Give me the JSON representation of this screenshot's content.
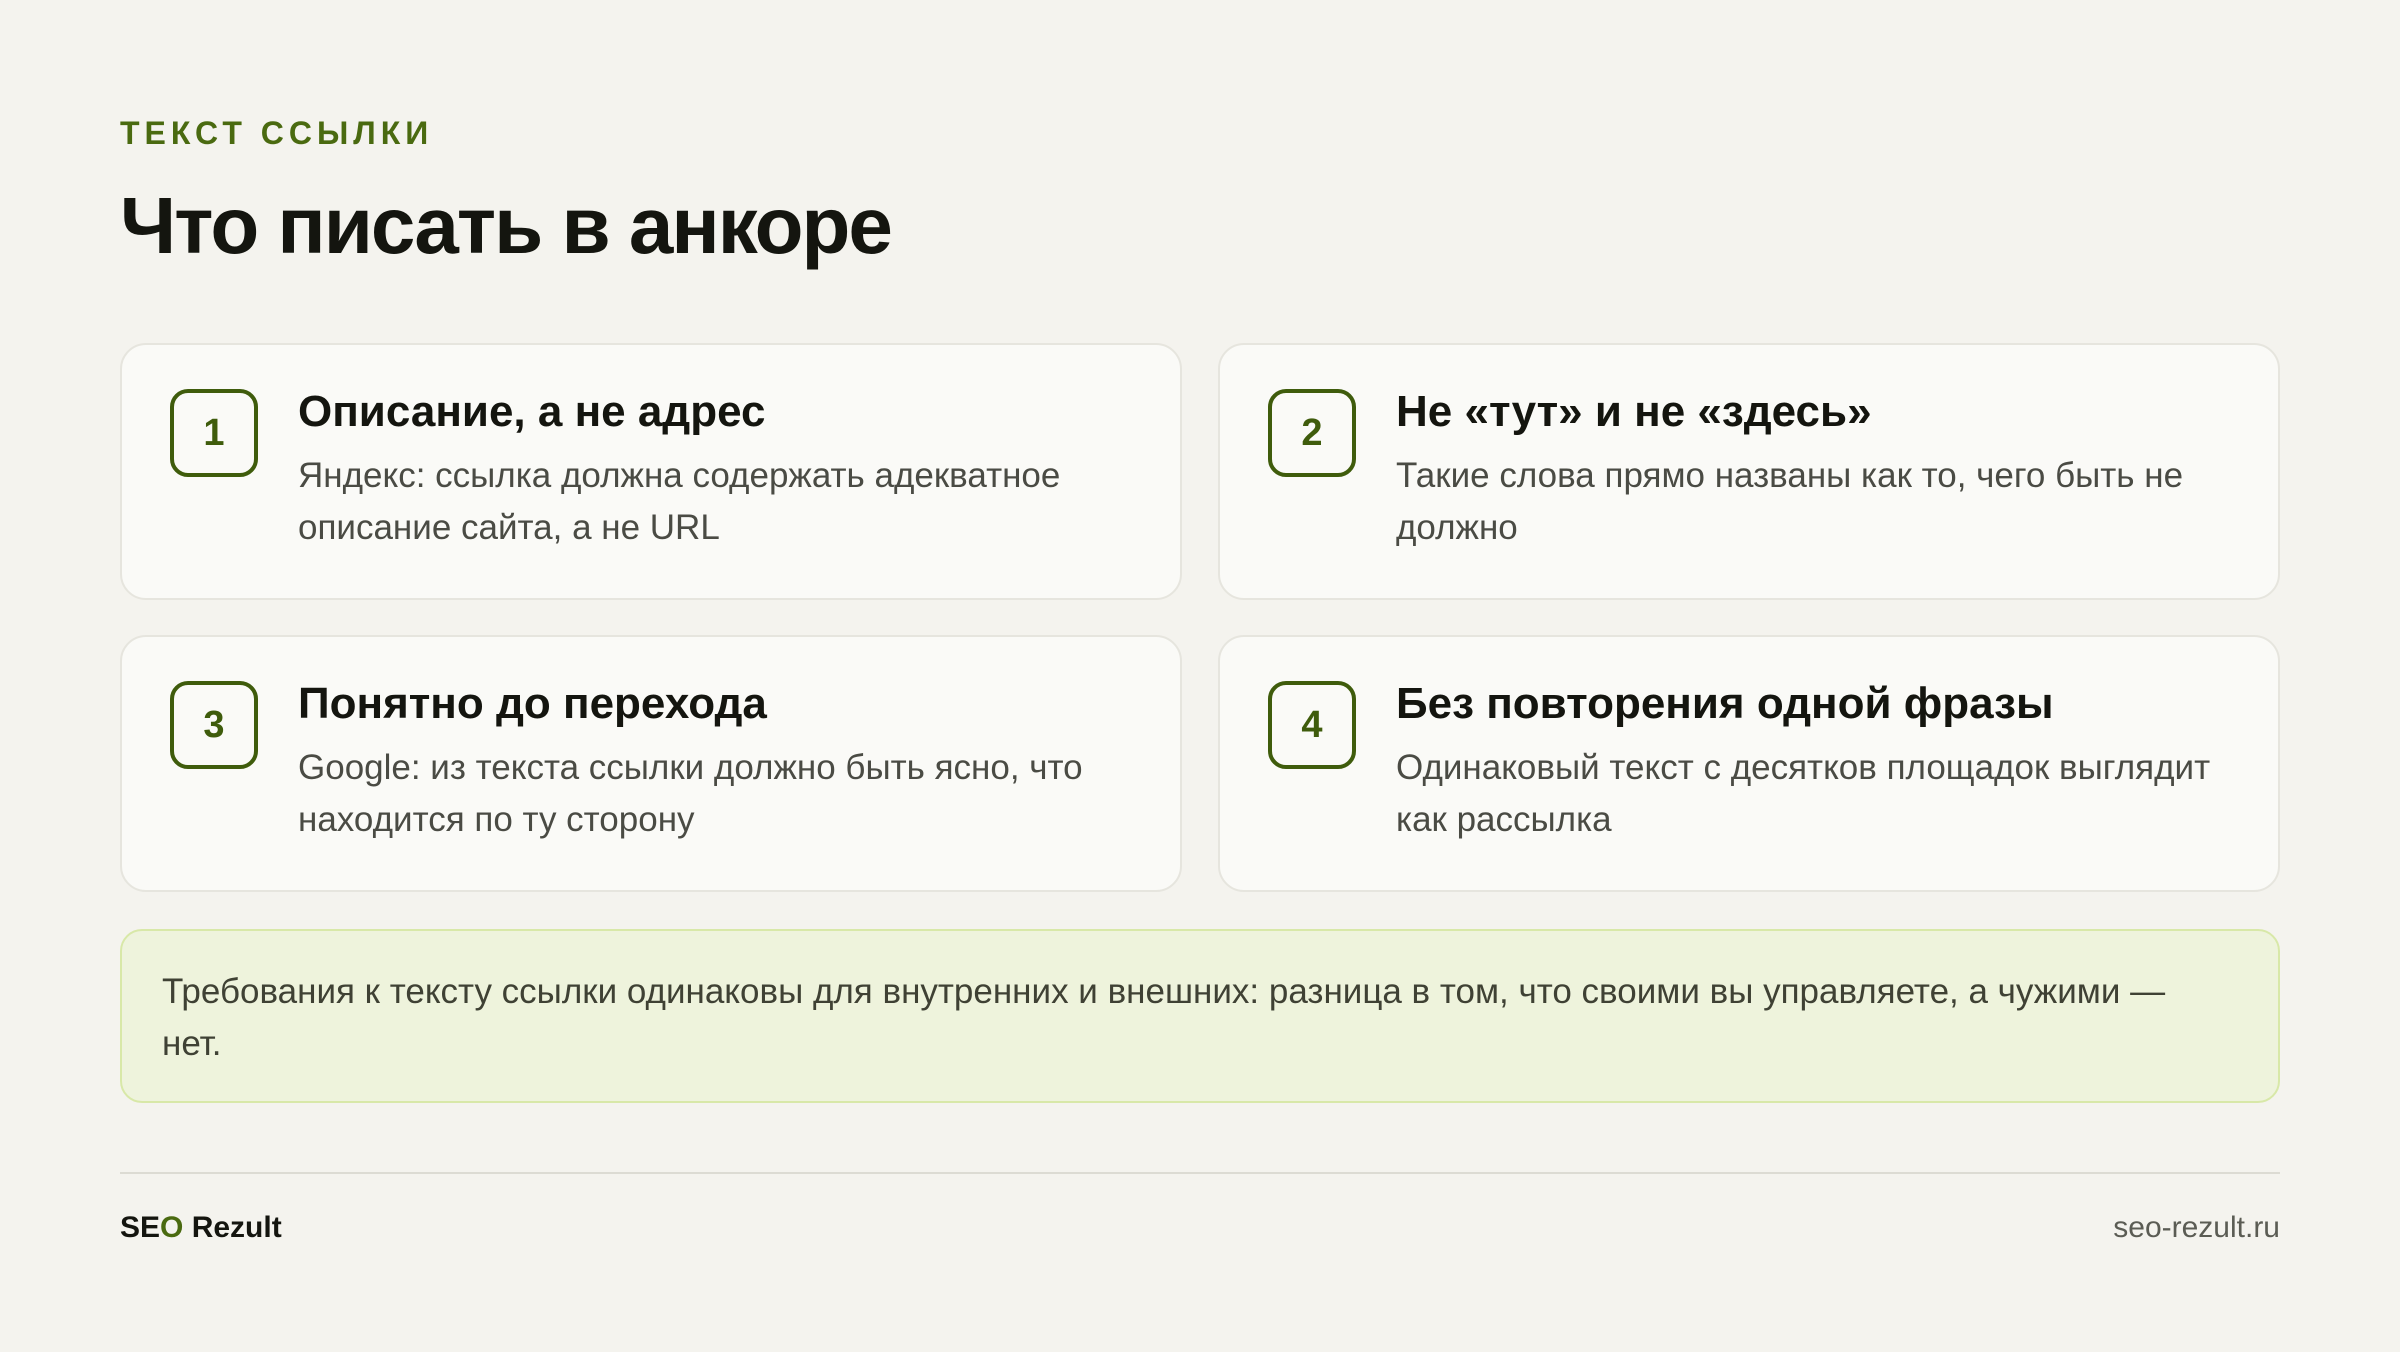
{
  "header": {
    "eyebrow": "ТЕКСТ ССЫЛКИ",
    "title": "Что писать в анкоре"
  },
  "cards": [
    {
      "number": "1",
      "title": "Описание, а не адрес",
      "text": "Яндекс: ссылка должна содержать адекватное описание сайта, а не URL"
    },
    {
      "number": "2",
      "title": "Не «тут» и не «здесь»",
      "text": "Такие слова прямо названы как то, чего быть не должно"
    },
    {
      "number": "3",
      "title": "Понятно до перехода",
      "text": "Google: из текста ссылки должно быть ясно, что находится по ту сторону"
    },
    {
      "number": "4",
      "title": "Без повторения одной фразы",
      "text": "Одинаковый текст с десятков площадок выглядит как рассылка"
    }
  ],
  "note": {
    "text": "Требования к тексту ссылки одинаковы для внутренних и внешних: разница в том, что своими вы управляете, а чужими — нет."
  },
  "footer": {
    "brand_part1": "SE",
    "brand_part2": "O",
    "brand_part3": " Rezult",
    "url": "seo-rezult.ru"
  },
  "colors": {
    "accent": "#4a6a10",
    "background": "#f4f3ee",
    "card_background": "#fafaf7",
    "note_background": "#eef3dc"
  }
}
